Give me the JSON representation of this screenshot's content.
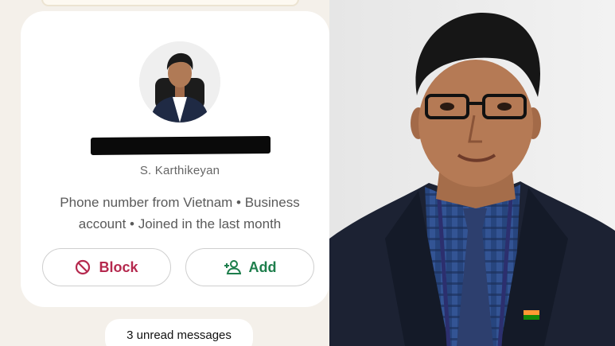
{
  "profile": {
    "name": "S. Karthikeyan",
    "info": "Phone number from Vietnam • Business account • Joined in the last month",
    "avatar_icon": "profile-photo"
  },
  "actions": {
    "block_label": "Block",
    "block_icon": "block-icon",
    "add_label": "Add",
    "add_icon": "add-person-icon"
  },
  "chat": {
    "unread_label": "3 unread messages"
  },
  "colors": {
    "block": "#b5294e",
    "add": "#1e7e4c",
    "background": "#f4f0ea"
  }
}
